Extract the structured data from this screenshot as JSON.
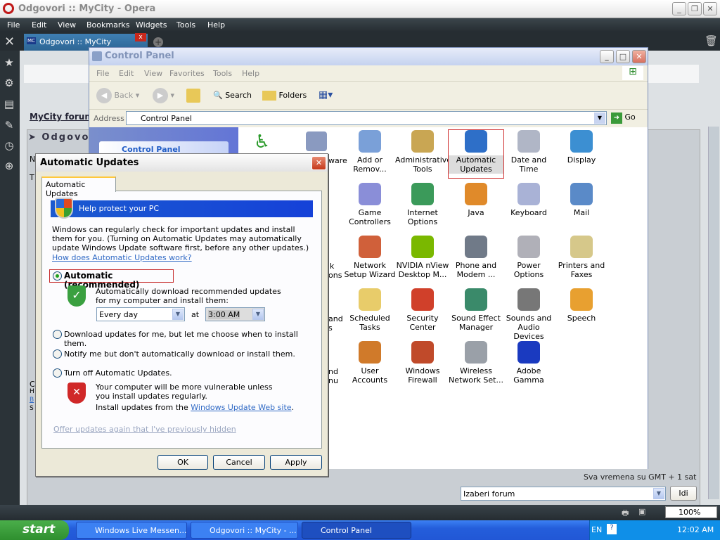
{
  "opera": {
    "title": "Odgovori :: MyCity - Opera",
    "menu": [
      "File",
      "Edit",
      "View",
      "Bookmarks",
      "Widgets",
      "Tools",
      "Help"
    ],
    "tab": "Odgovori :: MyCity",
    "tab_badge": "MC",
    "zoom": "100%"
  },
  "page": {
    "forum_link": "MyCity forum",
    "section": "Odgovor",
    "timezone": "Sva vremena su GMT + 1 sat",
    "forum_select": "Izaberi forum",
    "go": "Idi",
    "frag_left": [
      "N",
      "T",
      "C",
      "H",
      "B",
      "S"
    ]
  },
  "control_panel": {
    "title": "Control Panel",
    "menu": [
      "File",
      "Edit",
      "View",
      "Favorites",
      "Tools",
      "Help"
    ],
    "back": "Back",
    "search": "Search",
    "folders": "Folders",
    "address_label": "Address",
    "address": "Control Panel",
    "go": "Go",
    "left_pane_title": "Control Panel",
    "partial_labels": [
      "ware",
      "k",
      "ons",
      "and",
      "s",
      "nd",
      "nu"
    ],
    "items": [
      {
        "label": "Add or Remov...",
        "color": "#7aa0d8"
      },
      {
        "label": "Administrative Tools",
        "color": "#c9a653"
      },
      {
        "label": "Automatic Updates",
        "color": "#2e6fc8",
        "selected": true
      },
      {
        "label": "Date and Time",
        "color": "#b0b6c6"
      },
      {
        "label": "Display",
        "color": "#3c8fd2"
      },
      {
        "label": "Game Controllers",
        "color": "#8a8ed8"
      },
      {
        "label": "Internet Options",
        "color": "#3b9a5a"
      },
      {
        "label": "Java",
        "color": "#e08a2a"
      },
      {
        "label": "Keyboard",
        "color": "#a9b2d6"
      },
      {
        "label": "Mail",
        "color": "#5a8ac8"
      },
      {
        "label": "Network Setup Wizard",
        "color": "#d0603a"
      },
      {
        "label": "NVIDIA nView Desktop M...",
        "color": "#7ab800"
      },
      {
        "label": "Phone and Modem ...",
        "color": "#707a88"
      },
      {
        "label": "Power Options",
        "color": "#b0b0b8"
      },
      {
        "label": "Printers and Faxes",
        "color": "#d6c88a"
      },
      {
        "label": "Scheduled Tasks",
        "color": "#e8cc6a"
      },
      {
        "label": "Security Center",
        "color": "#d0402a"
      },
      {
        "label": "Sound Effect Manager",
        "color": "#3a8a6a"
      },
      {
        "label": "Sounds and Audio Devices",
        "color": "#777"
      },
      {
        "label": "Speech",
        "color": "#e8a030"
      },
      {
        "label": "User Accounts",
        "color": "#d07a2a"
      },
      {
        "label": "Windows Firewall",
        "color": "#c04a2a"
      },
      {
        "label": "Wireless Network Set...",
        "color": "#9aa0a8"
      },
      {
        "label": "Adobe Gamma",
        "color": "#1a3ac0"
      }
    ]
  },
  "dialog": {
    "title": "Automatic Updates",
    "tab": "Automatic Updates",
    "banner": "Help protect your PC",
    "intro": "Windows can regularly check for important updates and install them for you. (Turning on Automatic Updates may automatically update Windows Update software first, before any other updates.)",
    "how_link": "How does Automatic Updates work?",
    "opt_auto": "Automatic (recommended)",
    "auto_desc": "Automatically download recommended updates for my computer and install them:",
    "day": "Every day",
    "at": "at",
    "time": "3:00 AM",
    "opt_download": "Download updates for me, but let me choose when to install them.",
    "opt_notify": "Notify me but don't automatically download or install them.",
    "opt_off": "Turn off Automatic Updates.",
    "off_desc": "Your computer will be more vulnerable unless you install updates regularly.",
    "install_from": "Install updates from the ",
    "wu_link": "Windows Update Web site",
    "period": ".",
    "offer_link": "Offer updates again that I've previously hidden",
    "ok": "OK",
    "cancel": "Cancel",
    "apply": "Apply"
  },
  "taskbar": {
    "start": "start",
    "tasks": [
      "Windows Live Messen...",
      "Odgovori :: MyCity - ...",
      "Control Panel"
    ],
    "lang": "EN",
    "clock": "12:02 AM"
  }
}
